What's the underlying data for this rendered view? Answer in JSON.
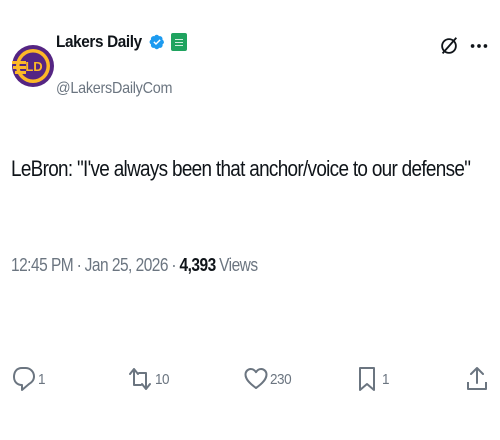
{
  "author": {
    "display_name": "Lakers Daily",
    "handle": "@LakersDailyCom",
    "avatar_text": "LD",
    "verified_color": "#1d9bf0",
    "affiliate_color": "#1fa35f"
  },
  "tweet": {
    "text": "LeBron: \"I've always been that anchor/voice to our defense\"",
    "time": "12:45 PM",
    "date": "Jan 25, 2026",
    "views_count": "4,393",
    "views_label": "Views"
  },
  "actions": {
    "replies": "1",
    "reposts": "10",
    "likes": "230",
    "bookmarks": "1"
  },
  "icons": {
    "more": "more-icon",
    "grok": "grok-icon"
  },
  "colors": {
    "text": "#0f1419",
    "secondary": "#6b7580",
    "lakers_purple": "#552583",
    "lakers_gold": "#fdb927"
  }
}
